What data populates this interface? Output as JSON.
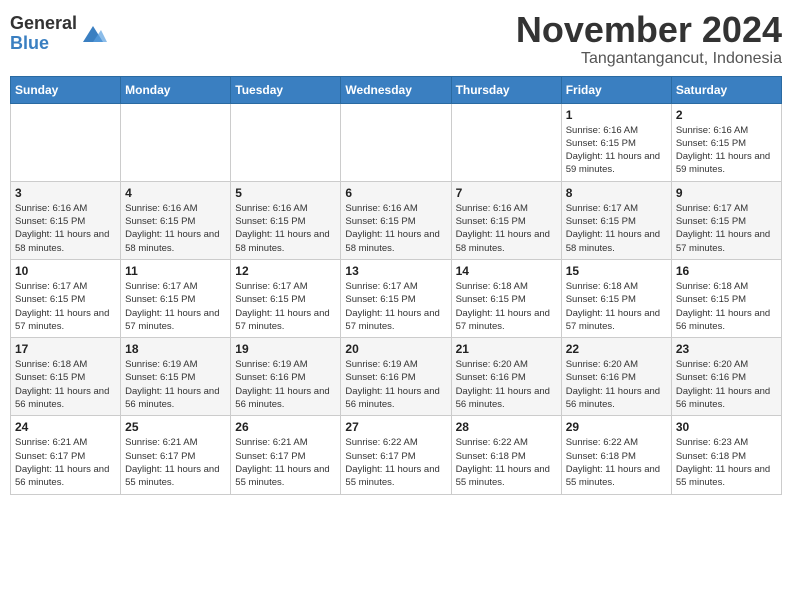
{
  "header": {
    "logo_general": "General",
    "logo_blue": "Blue",
    "month_title": "November 2024",
    "location": "Tangantangancut, Indonesia"
  },
  "weekdays": [
    "Sunday",
    "Monday",
    "Tuesday",
    "Wednesday",
    "Thursday",
    "Friday",
    "Saturday"
  ],
  "weeks": [
    [
      {
        "day": "",
        "sunrise": "",
        "sunset": "",
        "daylight": ""
      },
      {
        "day": "",
        "sunrise": "",
        "sunset": "",
        "daylight": ""
      },
      {
        "day": "",
        "sunrise": "",
        "sunset": "",
        "daylight": ""
      },
      {
        "day": "",
        "sunrise": "",
        "sunset": "",
        "daylight": ""
      },
      {
        "day": "",
        "sunrise": "",
        "sunset": "",
        "daylight": ""
      },
      {
        "day": "1",
        "sunrise": "Sunrise: 6:16 AM",
        "sunset": "Sunset: 6:15 PM",
        "daylight": "Daylight: 11 hours and 59 minutes."
      },
      {
        "day": "2",
        "sunrise": "Sunrise: 6:16 AM",
        "sunset": "Sunset: 6:15 PM",
        "daylight": "Daylight: 11 hours and 59 minutes."
      }
    ],
    [
      {
        "day": "3",
        "sunrise": "Sunrise: 6:16 AM",
        "sunset": "Sunset: 6:15 PM",
        "daylight": "Daylight: 11 hours and 58 minutes."
      },
      {
        "day": "4",
        "sunrise": "Sunrise: 6:16 AM",
        "sunset": "Sunset: 6:15 PM",
        "daylight": "Daylight: 11 hours and 58 minutes."
      },
      {
        "day": "5",
        "sunrise": "Sunrise: 6:16 AM",
        "sunset": "Sunset: 6:15 PM",
        "daylight": "Daylight: 11 hours and 58 minutes."
      },
      {
        "day": "6",
        "sunrise": "Sunrise: 6:16 AM",
        "sunset": "Sunset: 6:15 PM",
        "daylight": "Daylight: 11 hours and 58 minutes."
      },
      {
        "day": "7",
        "sunrise": "Sunrise: 6:16 AM",
        "sunset": "Sunset: 6:15 PM",
        "daylight": "Daylight: 11 hours and 58 minutes."
      },
      {
        "day": "8",
        "sunrise": "Sunrise: 6:17 AM",
        "sunset": "Sunset: 6:15 PM",
        "daylight": "Daylight: 11 hours and 58 minutes."
      },
      {
        "day": "9",
        "sunrise": "Sunrise: 6:17 AM",
        "sunset": "Sunset: 6:15 PM",
        "daylight": "Daylight: 11 hours and 57 minutes."
      }
    ],
    [
      {
        "day": "10",
        "sunrise": "Sunrise: 6:17 AM",
        "sunset": "Sunset: 6:15 PM",
        "daylight": "Daylight: 11 hours and 57 minutes."
      },
      {
        "day": "11",
        "sunrise": "Sunrise: 6:17 AM",
        "sunset": "Sunset: 6:15 PM",
        "daylight": "Daylight: 11 hours and 57 minutes."
      },
      {
        "day": "12",
        "sunrise": "Sunrise: 6:17 AM",
        "sunset": "Sunset: 6:15 PM",
        "daylight": "Daylight: 11 hours and 57 minutes."
      },
      {
        "day": "13",
        "sunrise": "Sunrise: 6:17 AM",
        "sunset": "Sunset: 6:15 PM",
        "daylight": "Daylight: 11 hours and 57 minutes."
      },
      {
        "day": "14",
        "sunrise": "Sunrise: 6:18 AM",
        "sunset": "Sunset: 6:15 PM",
        "daylight": "Daylight: 11 hours and 57 minutes."
      },
      {
        "day": "15",
        "sunrise": "Sunrise: 6:18 AM",
        "sunset": "Sunset: 6:15 PM",
        "daylight": "Daylight: 11 hours and 57 minutes."
      },
      {
        "day": "16",
        "sunrise": "Sunrise: 6:18 AM",
        "sunset": "Sunset: 6:15 PM",
        "daylight": "Daylight: 11 hours and 56 minutes."
      }
    ],
    [
      {
        "day": "17",
        "sunrise": "Sunrise: 6:18 AM",
        "sunset": "Sunset: 6:15 PM",
        "daylight": "Daylight: 11 hours and 56 minutes."
      },
      {
        "day": "18",
        "sunrise": "Sunrise: 6:19 AM",
        "sunset": "Sunset: 6:15 PM",
        "daylight": "Daylight: 11 hours and 56 minutes."
      },
      {
        "day": "19",
        "sunrise": "Sunrise: 6:19 AM",
        "sunset": "Sunset: 6:16 PM",
        "daylight": "Daylight: 11 hours and 56 minutes."
      },
      {
        "day": "20",
        "sunrise": "Sunrise: 6:19 AM",
        "sunset": "Sunset: 6:16 PM",
        "daylight": "Daylight: 11 hours and 56 minutes."
      },
      {
        "day": "21",
        "sunrise": "Sunrise: 6:20 AM",
        "sunset": "Sunset: 6:16 PM",
        "daylight": "Daylight: 11 hours and 56 minutes."
      },
      {
        "day": "22",
        "sunrise": "Sunrise: 6:20 AM",
        "sunset": "Sunset: 6:16 PM",
        "daylight": "Daylight: 11 hours and 56 minutes."
      },
      {
        "day": "23",
        "sunrise": "Sunrise: 6:20 AM",
        "sunset": "Sunset: 6:16 PM",
        "daylight": "Daylight: 11 hours and 56 minutes."
      }
    ],
    [
      {
        "day": "24",
        "sunrise": "Sunrise: 6:21 AM",
        "sunset": "Sunset: 6:17 PM",
        "daylight": "Daylight: 11 hours and 56 minutes."
      },
      {
        "day": "25",
        "sunrise": "Sunrise: 6:21 AM",
        "sunset": "Sunset: 6:17 PM",
        "daylight": "Daylight: 11 hours and 55 minutes."
      },
      {
        "day": "26",
        "sunrise": "Sunrise: 6:21 AM",
        "sunset": "Sunset: 6:17 PM",
        "daylight": "Daylight: 11 hours and 55 minutes."
      },
      {
        "day": "27",
        "sunrise": "Sunrise: 6:22 AM",
        "sunset": "Sunset: 6:17 PM",
        "daylight": "Daylight: 11 hours and 55 minutes."
      },
      {
        "day": "28",
        "sunrise": "Sunrise: 6:22 AM",
        "sunset": "Sunset: 6:18 PM",
        "daylight": "Daylight: 11 hours and 55 minutes."
      },
      {
        "day": "29",
        "sunrise": "Sunrise: 6:22 AM",
        "sunset": "Sunset: 6:18 PM",
        "daylight": "Daylight: 11 hours and 55 minutes."
      },
      {
        "day": "30",
        "sunrise": "Sunrise: 6:23 AM",
        "sunset": "Sunset: 6:18 PM",
        "daylight": "Daylight: 11 hours and 55 minutes."
      }
    ]
  ]
}
